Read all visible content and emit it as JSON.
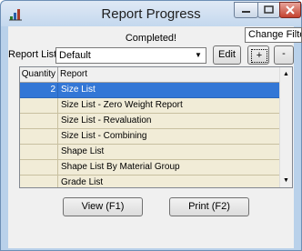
{
  "window": {
    "title": "Report Progress",
    "tooltip": "Change Filters"
  },
  "status": "Completed!",
  "report_list": {
    "label": "Report List:",
    "selected": "Default",
    "edit_label": "Edit",
    "add_label": "+",
    "remove_label": "-"
  },
  "grid": {
    "headers": [
      "Quantity",
      "Report"
    ],
    "rows": [
      {
        "qty": "2",
        "report": "Size List"
      },
      {
        "qty": "",
        "report": "Size List - Zero Weight Report"
      },
      {
        "qty": "",
        "report": "Size List - Revaluation"
      },
      {
        "qty": "",
        "report": "Size List - Combining"
      },
      {
        "qty": "",
        "report": "Shape List"
      },
      {
        "qty": "",
        "report": "Shape List By Material Group"
      },
      {
        "qty": "",
        "report": "Grade List"
      },
      {
        "qty": "",
        "report": ""
      }
    ]
  },
  "actions": {
    "view_label": "View (F1)",
    "print_label": "Print (F2)"
  },
  "icons": {
    "app": "chart-icon",
    "minimize": "minimize-icon",
    "maximize": "maximize-icon",
    "close": "close-icon"
  },
  "colors": {
    "selection": "#3377d6",
    "row_bg": "#f1ecd7",
    "close_button": "#c4422f"
  }
}
